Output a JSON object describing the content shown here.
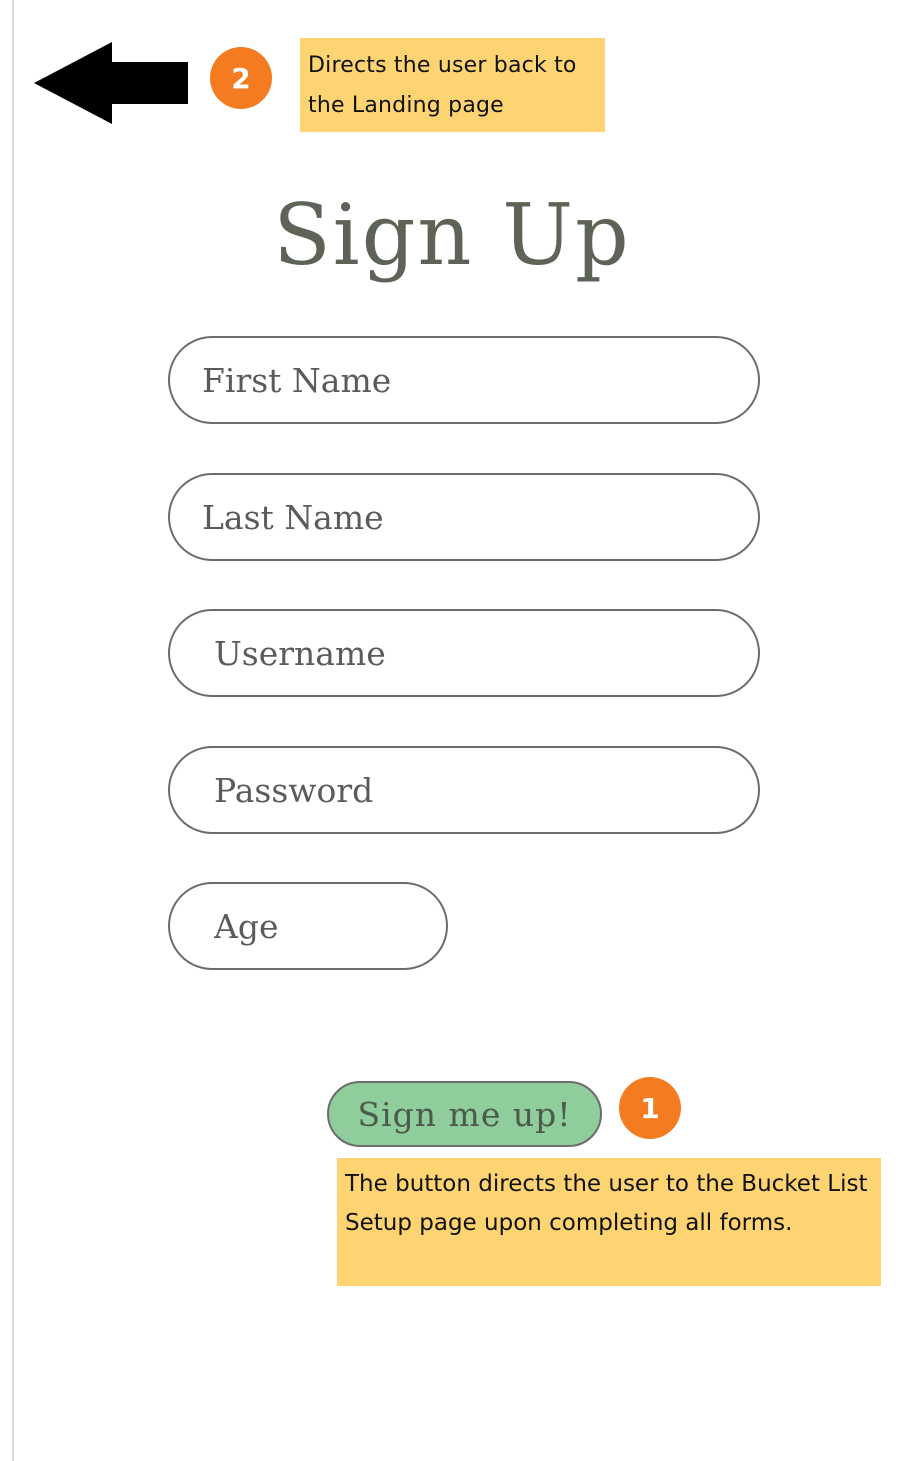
{
  "header": {
    "back_icon": "left-arrow-icon",
    "annotation_2": {
      "badge": "2",
      "text": "Directs the user back to the Landing page"
    }
  },
  "form": {
    "title": "Sign Up",
    "fields": [
      {
        "placeholder": "First Name",
        "value": ""
      },
      {
        "placeholder": "Last Name",
        "value": ""
      },
      {
        "placeholder": "Username",
        "value": ""
      },
      {
        "placeholder": "Password",
        "value": ""
      },
      {
        "placeholder": "Age",
        "value": ""
      }
    ],
    "submit_label": "Sign me up!"
  },
  "annotation_1": {
    "badge": "1",
    "text": "The button directs the user to the Bucket List Setup page upon completing all forms."
  },
  "colors": {
    "badge": "#f47b20",
    "note_background": "#fdd471",
    "button_background": "#8fcd9d",
    "title_text": "#5e6357"
  }
}
